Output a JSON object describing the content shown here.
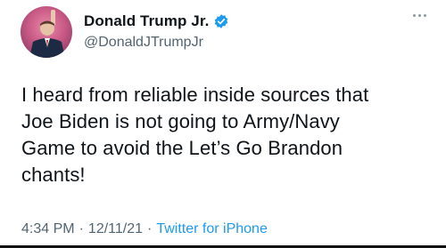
{
  "user": {
    "display_name": "Donald Trump Jr.",
    "handle": "@DonaldJTrumpJr",
    "verified": true
  },
  "tweet": {
    "text": "I heard from reliable inside sources that\nJoe Biden is not going to Army/Navy\nGame to avoid the Let’s Go Brandon\nchants!",
    "time": "4:34 PM",
    "separator": "·",
    "date": "12/11/21",
    "source": "Twitter for iPhone"
  },
  "colors": {
    "verified_badge": "#1d9bf0",
    "link": "#1d9bf0",
    "secondary_text": "#536471"
  },
  "icons": {
    "verified": "verified-badge-icon",
    "more": "more-options-icon"
  }
}
